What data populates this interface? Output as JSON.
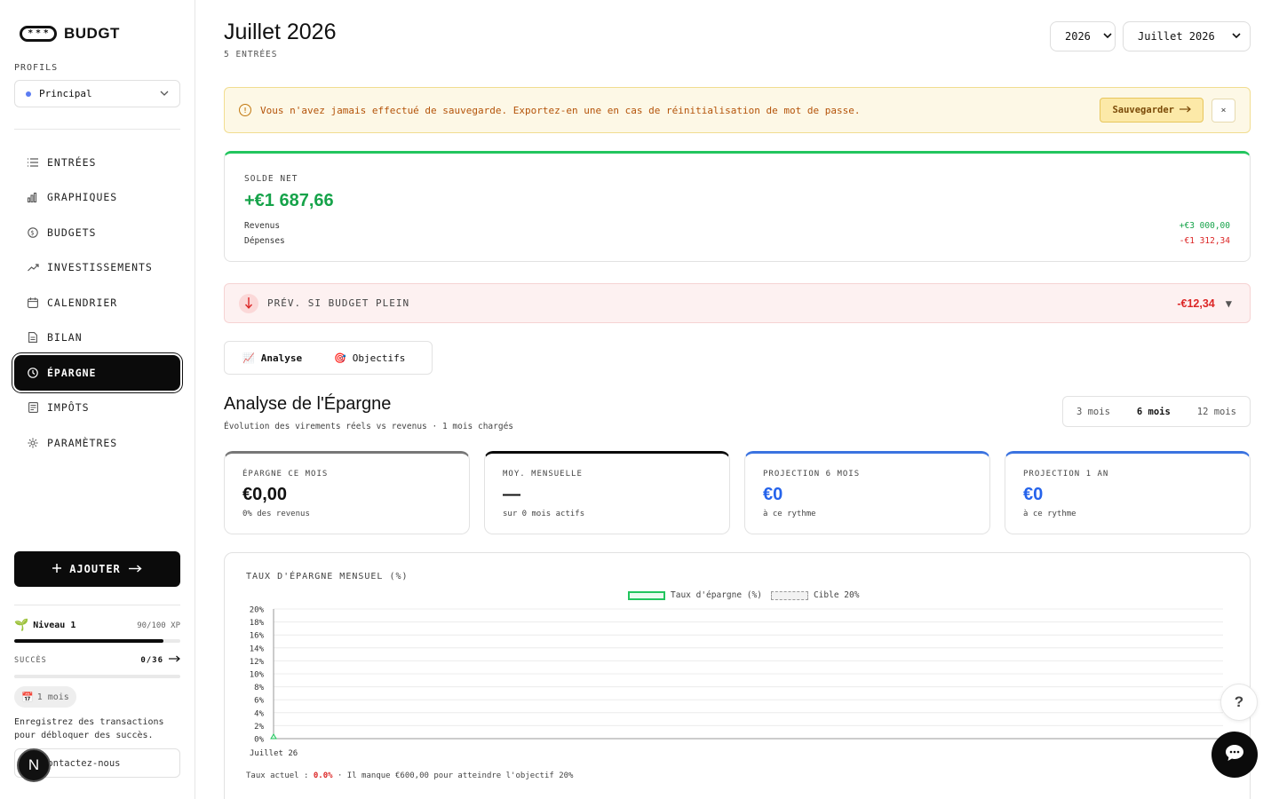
{
  "app": {
    "logo_text": "BUDGT",
    "logo_pill": "* * *"
  },
  "sidebar": {
    "profiles_label": "PROFILS",
    "profile": {
      "name": "Principal",
      "dot_color": "#5b7cf2"
    },
    "nav": [
      {
        "label": "ENTRÉES",
        "icon": "list-icon"
      },
      {
        "label": "GRAPHIQUES",
        "icon": "bar-chart-icon"
      },
      {
        "label": "BUDGETS",
        "icon": "coin-icon"
      },
      {
        "label": "INVESTISSEMENTS",
        "icon": "trending-up-icon"
      },
      {
        "label": "CALENDRIER",
        "icon": "calendar-icon"
      },
      {
        "label": "BILAN",
        "icon": "document-icon"
      },
      {
        "label": "ÉPARGNE",
        "icon": "clock-icon",
        "active": true
      },
      {
        "label": "IMPÔTS",
        "icon": "receipt-icon"
      },
      {
        "label": "PARAMÈTRES",
        "icon": "gear-icon"
      }
    ],
    "add_button": "AJOUTER",
    "level": {
      "emoji": "🌱",
      "label": "Niveau 1",
      "xp": "90/100 XP",
      "progress": 0.9
    },
    "succes": {
      "label": "SUCCÈS",
      "count": "0/36"
    },
    "month_chip": {
      "emoji": "📅",
      "label": "1 mois"
    },
    "hint": "Enregistrez des transactions pour débloquer des succès.",
    "contact": "Contactez-nous",
    "n_badge": "N"
  },
  "header": {
    "title": "Juillet 2026",
    "subtitle": "5 ENTRÉES",
    "year_select": "2026",
    "month_select": "Juillet 2026"
  },
  "warning": {
    "text": "Vous n'avez jamais effectué de sauvegarde. Exportez-en une en cas de réinitialisation de mot de passe.",
    "button": "Sauvegarder",
    "close": "×"
  },
  "solde": {
    "label": "SOLDE NET",
    "value": "+€1 687,66",
    "revenus_label": "Revenus",
    "revenus_value": "+€3 000,00",
    "depenses_label": "Dépenses",
    "depenses_value": "-€1 312,34",
    "accent": "#22c55e"
  },
  "prevision": {
    "label": "PRÉV. SI BUDGET PLEIN",
    "value": "-€12,34",
    "caret": "▼"
  },
  "tabs": [
    {
      "emoji": "📈",
      "label": "Analyse",
      "active": true
    },
    {
      "emoji": "🎯",
      "label": "Objectifs"
    }
  ],
  "analyse": {
    "title": "Analyse de l'Épargne",
    "subtitle": "Évolution des virements réels vs revenus · 1 mois chargés",
    "periods": [
      {
        "label": "3 mois"
      },
      {
        "label": "6 mois",
        "active": true
      },
      {
        "label": "12 mois"
      }
    ]
  },
  "kpis": [
    {
      "label": "ÉPARGNE CE MOIS",
      "value": "€0,00",
      "sub": "0% des revenus",
      "accent": "#777777",
      "value_color": "#111111"
    },
    {
      "label": "MOY. MENSUELLE",
      "value": "—",
      "sub": "sur 0 mois actifs",
      "accent": "#0b0b0b",
      "value_color": "#111111"
    },
    {
      "label": "PROJECTION 6 MOIS",
      "value": "€0",
      "sub": "à ce rythme",
      "accent": "#3b73e0",
      "value_color": "#2563eb"
    },
    {
      "label": "PROJECTION 1 AN",
      "value": "€0",
      "sub": "à ce rythme",
      "accent": "#3b73e0",
      "value_color": "#2563eb"
    }
  ],
  "chart_card": {
    "title": "TAUX D'ÉPARGNE MENSUEL (%)",
    "footer_prefix": "Taux actuel : ",
    "footer_rate": "0.0%",
    "footer_suffix": " · Il manque €600,00 pour atteindre l'objectif 20%"
  },
  "chart_data": {
    "type": "line",
    "title": "TAUX D'ÉPARGNE MENSUEL (%)",
    "categories": [
      "Juillet 26"
    ],
    "series": [
      {
        "name": "Taux d'épargne (%)",
        "values": [
          0
        ],
        "color": "#22c55e"
      },
      {
        "name": "Cible 20%",
        "values": [
          20
        ],
        "color": "#999999",
        "style": "dashed"
      }
    ],
    "yticks": [
      "0%",
      "2%",
      "4%",
      "6%",
      "8%",
      "10%",
      "12%",
      "14%",
      "16%",
      "18%",
      "20%"
    ],
    "ylim": [
      0,
      20
    ],
    "grid": true,
    "legend": "top-center"
  },
  "floating": {
    "help": "?"
  }
}
